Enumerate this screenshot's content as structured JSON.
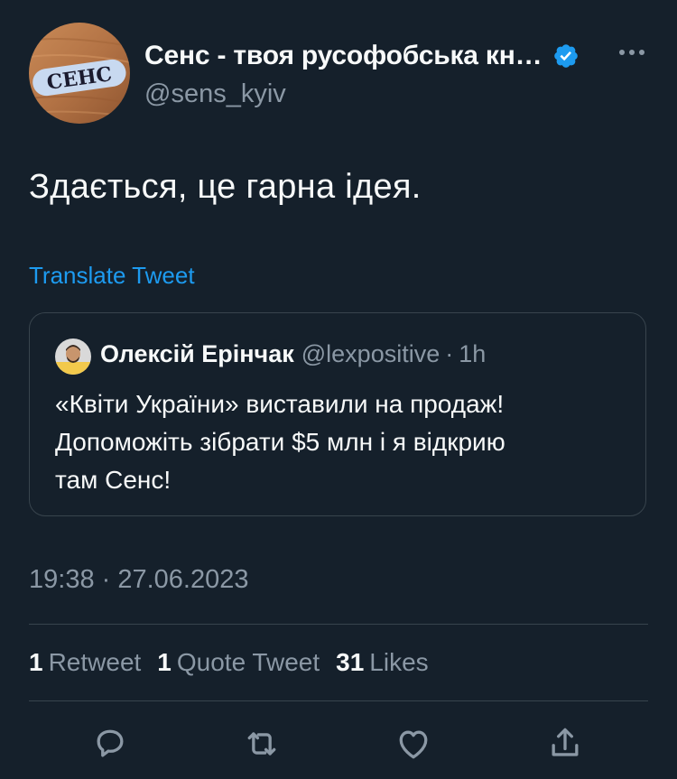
{
  "tweet": {
    "author_name": "Сенс - твоя русофобська кн…",
    "author_handle": "@sens_kyiv",
    "avatar_logo_text": "СЕНС",
    "text": "Здається, це гарна ідея.",
    "translate_label": "Translate Tweet",
    "timestamp": "19:38 · 27.06.2023",
    "icons": {
      "verified": "verified-badge-icon",
      "more": "more-options-icon"
    },
    "colors": {
      "background": "#15202b",
      "link": "#1d9bf0",
      "muted": "#8b98a5",
      "divider": "#38444d"
    }
  },
  "quote": {
    "author_name": "Олексій Ерінчак",
    "author_handle": "@lexpositive",
    "separator": "·",
    "time": "1h",
    "lines": [
      "«Квіти України» виставили на продаж!",
      "Допоможіть зібрати $5 млн і я відкрию",
      "там Сенс!"
    ]
  },
  "stats": [
    {
      "count": "1",
      "label": "Retweet"
    },
    {
      "count": "1",
      "label": "Quote Tweet"
    },
    {
      "count": "31",
      "label": "Likes"
    }
  ],
  "actions": [
    {
      "name": "reply-icon"
    },
    {
      "name": "retweet-icon"
    },
    {
      "name": "like-icon"
    },
    {
      "name": "share-icon"
    }
  ]
}
